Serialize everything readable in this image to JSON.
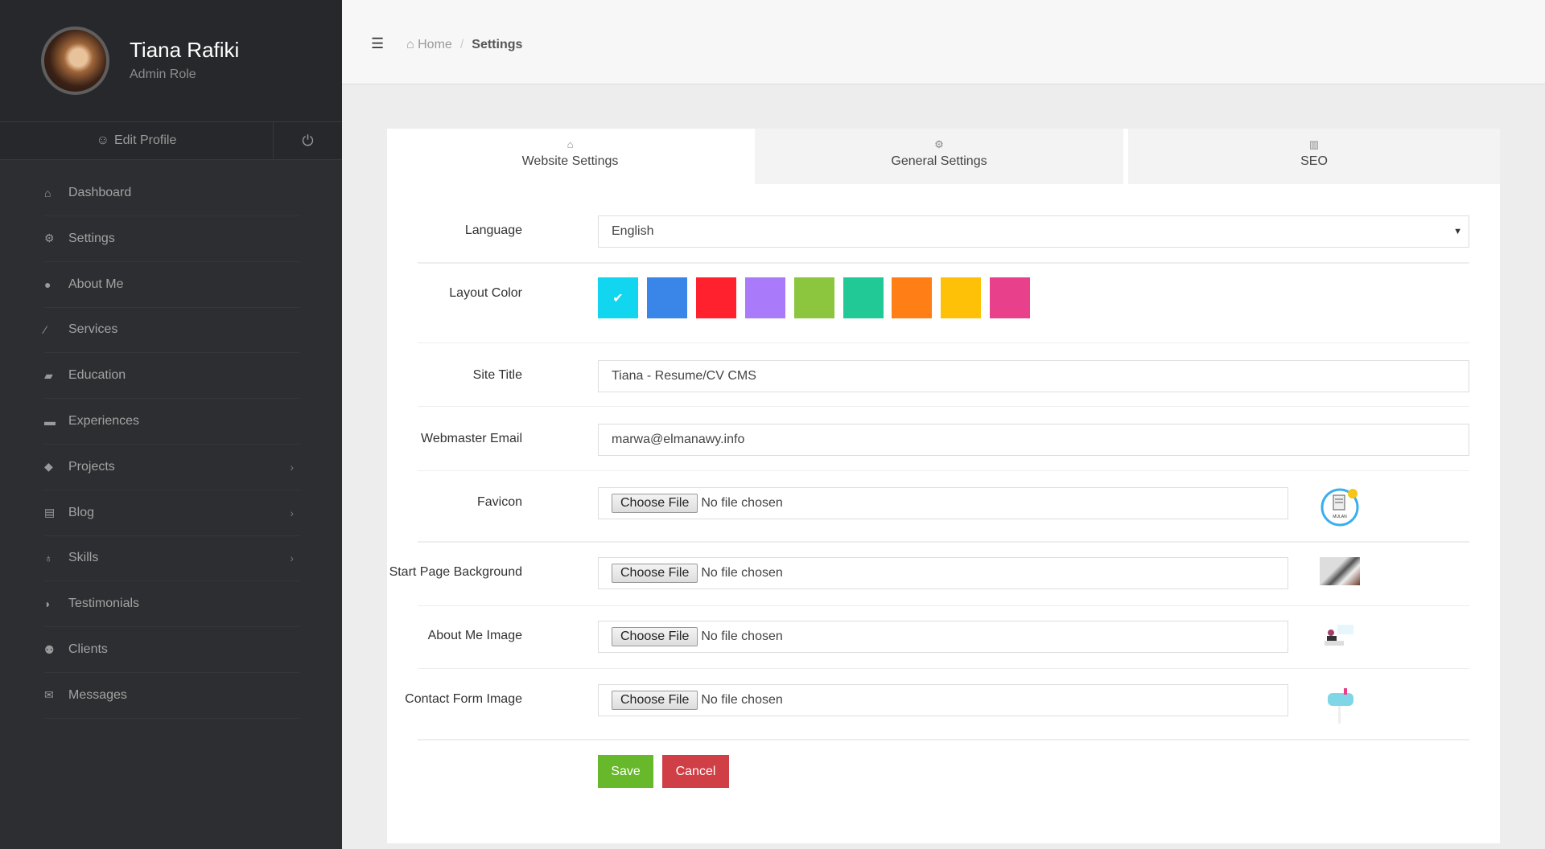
{
  "user": {
    "name": "Tiana Rafiki",
    "role": "Admin Role",
    "edit_profile": "Edit Profile"
  },
  "sidebar": {
    "items": [
      {
        "label": "Dashboard",
        "icon": "home-icon",
        "glyph": "⌂"
      },
      {
        "label": "Settings",
        "icon": "cogs-icon",
        "glyph": "⚙"
      },
      {
        "label": "About Me",
        "icon": "user-icon",
        "glyph": "●"
      },
      {
        "label": "Services",
        "icon": "magic-wand-icon",
        "glyph": "⁄"
      },
      {
        "label": "Education",
        "icon": "graduation-cap-icon",
        "glyph": "▰"
      },
      {
        "label": "Experiences",
        "icon": "briefcase-icon",
        "glyph": "▬"
      },
      {
        "label": "Projects",
        "icon": "tags-icon",
        "glyph": "◆",
        "has_submenu": true
      },
      {
        "label": "Blog",
        "icon": "newspaper-icon",
        "glyph": "▤",
        "has_submenu": true
      },
      {
        "label": "Skills",
        "icon": "lightbulb-icon",
        "glyph": "♁",
        "has_submenu": true
      },
      {
        "label": "Testimonials",
        "icon": "comments-icon",
        "glyph": "◗"
      },
      {
        "label": "Clients",
        "icon": "users-icon",
        "glyph": "⚉"
      },
      {
        "label": "Messages",
        "icon": "envelope-icon",
        "glyph": "✉"
      }
    ]
  },
  "breadcrumb": {
    "home": "Home",
    "separator": "/",
    "current": "Settings"
  },
  "tabs": [
    {
      "label": "Website Settings",
      "icon": "home-icon",
      "glyph": "⌂",
      "active": true
    },
    {
      "label": "General Settings",
      "icon": "cogs-icon",
      "glyph": "⚙"
    },
    {
      "label": "SEO",
      "icon": "bar-chart-icon",
      "glyph": "▥"
    }
  ],
  "form": {
    "language": {
      "label": "Language",
      "value": "English"
    },
    "layout_color": {
      "label": "Layout Color",
      "selected": "#12d5ef",
      "options": [
        "#12d5ef",
        "#3a86e8",
        "#ff222e",
        "#a97bfa",
        "#8cc63f",
        "#21c997",
        "#ff7f16",
        "#ffc107",
        "#e8408b"
      ]
    },
    "site_title": {
      "label": "Site Title",
      "value": "Tiana - Resume/CV CMS"
    },
    "webmaster_email": {
      "label": "Webmaster Email",
      "value": "marwa@elmanawy.info"
    },
    "files": [
      {
        "label": "Favicon",
        "button": "Choose File",
        "status": "No file chosen"
      },
      {
        "label": "Start Page Background",
        "button": "Choose File",
        "status": "No file chosen"
      },
      {
        "label": "About Me Image",
        "button": "Choose File",
        "status": "No file chosen"
      },
      {
        "label": "Contact Form Image",
        "button": "Choose File",
        "status": "No file chosen"
      }
    ],
    "favicon_logo_text": "MULAN",
    "save": "Save",
    "cancel": "Cancel",
    "save_color": "#67b82a",
    "cancel_color": "#cf3f45"
  }
}
